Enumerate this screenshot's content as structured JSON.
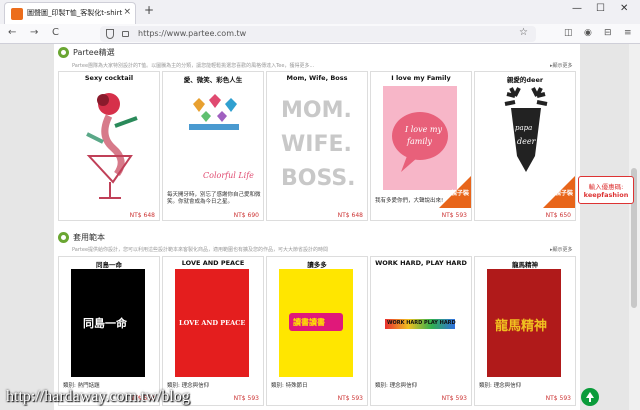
{
  "browser": {
    "tab_title": "圖聲圖_印製T恤_客製化t-shirt | ",
    "url": "https://www.partee.com.tw",
    "new_tab": "+",
    "close_tab": "×",
    "back": "←",
    "forward": "→",
    "reload": "C",
    "star": "☆",
    "window_minimize": "—",
    "window_maximize": "☐",
    "window_close": "✕"
  },
  "section1": {
    "name": "Partee精選",
    "desc": "Partee團隊為大家特別設計的T恤。以圖騰為主的分類，讓您能輕鬆挑選您喜歡的風格傳達入Tee，獲得更多...",
    "more": "▸顯示更多",
    "cards": [
      {
        "title": "Sexy cocktail",
        "price": "NT$ 648"
      },
      {
        "title": "愛、微笑、彩色人生",
        "price": "NT$ 690",
        "desc": "每天開牙時，別忘了感謝你自己愛和微笑。你就會成為今日之星。"
      },
      {
        "title": "Mom, Wife, Boss",
        "price": "NT$ 648",
        "art_lines": [
          "MOM.",
          "WIFE.",
          "BOSS."
        ]
      },
      {
        "title": "I love my Family",
        "price": "NT$ 593",
        "desc": "我有多愛你們，大聲說出來!",
        "badge": "親子裝"
      },
      {
        "title": "親愛的deer",
        "price": "NT$ 650",
        "badge": "親子裝"
      }
    ]
  },
  "section2": {
    "name": "套用範本",
    "desc": "Partee提供給你設計，您可以利用這些設計範本來客製化商品，適用範圍也有擴及您的作品，可大大節省設計的時間",
    "more": "▸顯示更多",
    "cards": [
      {
        "title": "同島一命",
        "price": "NT$ 593",
        "cat": "類別: 熱門話題",
        "art_text": "同島一命"
      },
      {
        "title": "LOVE AND PEACE",
        "price": "NT$ 593",
        "cat": "類別: 理念與信仰",
        "art_text": "LOVE AND PEACE"
      },
      {
        "title": "讀多多",
        "price": "NT$ 593",
        "cat": "類別: 特殊節日",
        "art_text": "讀書讀書"
      },
      {
        "title": "WORK HARD, PLAY HARD",
        "price": "NT$ 593",
        "cat": "類別: 理念與信仰",
        "art_text": "WORK HARD PLAY HARD"
      },
      {
        "title": "龍馬精神",
        "price": "NT$ 593",
        "cat": "類別: 理念與信仰",
        "art_text": "龍馬精神"
      }
    ]
  },
  "promo": {
    "line1": "輸入優惠碼:",
    "line2": "keepfashion"
  },
  "watermark": "http://hardaway.com.tw/blog",
  "colors": {
    "accent": "#6aa632",
    "price": "#cc3333",
    "badge": "#e8651a",
    "totop": "#0a9b3a"
  }
}
